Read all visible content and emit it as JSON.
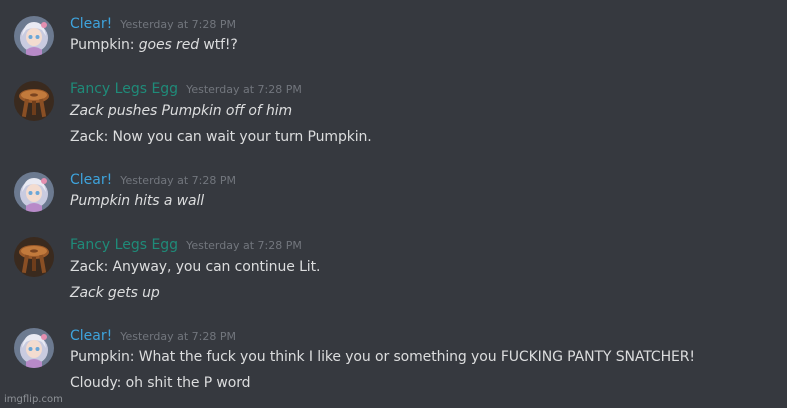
{
  "colors": {
    "background": "#36393f",
    "clear_name": "#3ea3dc",
    "egg_name": "#1f8b79",
    "timestamp": "#72767d",
    "text": "#dcddde"
  },
  "messages": [
    {
      "author": "Clear!",
      "timestamp": "Yesterday at 7:28 PM",
      "avatar": "anime-girl-avatar",
      "lines": [
        {
          "plain": "Pumpkin: ",
          "italic": "goes red",
          "tail": " wtf!?"
        }
      ]
    },
    {
      "author": "Fancy Legs Egg",
      "timestamp": "Yesterday at 7:28 PM",
      "avatar": "wooden-stool-avatar",
      "lines": [
        {
          "plain": "",
          "italic": "Zack pushes Pumpkin off of him",
          "tail": ""
        },
        {
          "plain": "Zack: Now you can wait your turn Pumpkin.",
          "italic": "",
          "tail": ""
        }
      ]
    },
    {
      "author": "Clear!",
      "timestamp": "Yesterday at 7:28 PM",
      "avatar": "anime-girl-avatar",
      "lines": [
        {
          "plain": "",
          "italic": "Pumpkin hits a wall",
          "tail": ""
        }
      ]
    },
    {
      "author": "Fancy Legs Egg",
      "timestamp": "Yesterday at 7:28 PM",
      "avatar": "wooden-stool-avatar",
      "lines": [
        {
          "plain": "Zack: Anyway, you can continue Lit.",
          "italic": "",
          "tail": ""
        },
        {
          "plain": "",
          "italic": "Zack gets up",
          "tail": ""
        }
      ]
    },
    {
      "author": "Clear!",
      "timestamp": "Yesterday at 7:28 PM",
      "avatar": "anime-girl-avatar",
      "lines": [
        {
          "plain": "Pumpkin: What the fuck you think I like you or something you FUCKING PANTY SNATCHER!",
          "italic": "",
          "tail": ""
        },
        {
          "plain": "Cloudy: oh shit the P word",
          "italic": "",
          "tail": ""
        }
      ]
    }
  ],
  "watermark": "imgflip.com"
}
